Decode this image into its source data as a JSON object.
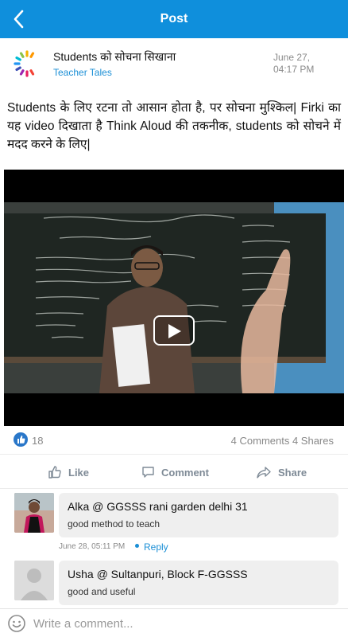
{
  "header": {
    "title": "Post",
    "back_icon": "chevron-left-icon",
    "bg_color": "#0f8fdc"
  },
  "post": {
    "title": "Students को सोचना सिखाना",
    "author": "Teacher Tales",
    "date_line1": "June 27,",
    "date_line2": "04:17 PM",
    "body": "Students के लिए रटना तो आसान होता है, पर सोचना मुश्किल| Firki का यह video दिखाता है Think Aloud की तकनीक, students को सोचने में मदद करने के लिए|",
    "video": {
      "state": "paused",
      "play_icon": "play-icon"
    }
  },
  "stats": {
    "likes": "18",
    "comments_shares": "4 Comments 4 Shares"
  },
  "actions": {
    "like": "Like",
    "comment": "Comment",
    "share": "Share"
  },
  "comments": [
    {
      "name": "Alka @ GGSSS rani garden delhi 31",
      "text": "good method to teach",
      "time": "June 28, 05:11 PM",
      "reply": "Reply"
    },
    {
      "name": "Usha @ Sultanpuri, Block F-GGSSS",
      "text": "good and useful",
      "time": "",
      "reply": ""
    }
  ],
  "composer": {
    "placeholder": "Write a comment...",
    "emoji_icon": "smiley-icon"
  },
  "colors": {
    "accent": "#1b8fd6",
    "like_badge": "#2a77c9"
  }
}
